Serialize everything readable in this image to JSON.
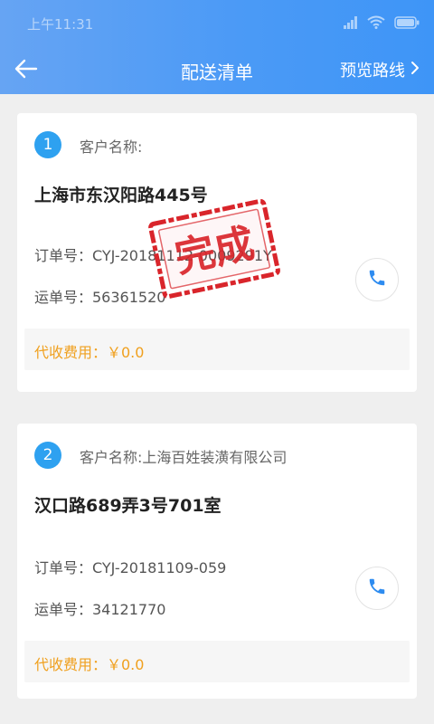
{
  "status_bar": {
    "time": "上午11:31",
    "icons": [
      "signal-icon",
      "wifi-icon",
      "battery-icon"
    ]
  },
  "nav": {
    "title": "配送清单",
    "right_action": "预览路线"
  },
  "orders": [
    {
      "index": "1",
      "customer": "客户名称:",
      "address": "上海市东汉阳路445号",
      "order_no": "订单号：CYJ-20181112-0009291Y",
      "waybill_no": "运单号：56361520",
      "fee": "代收费用：￥0.0",
      "stamp_text": "完成"
    },
    {
      "index": "2",
      "customer": "客户名称:上海百姓装潢有限公司",
      "address": "汉口路689弄3号701室",
      "order_no": "订单号：CYJ-20181109-059",
      "waybill_no": "运单号：34121770",
      "fee": "代收费用：￥0.0"
    }
  ],
  "colors": {
    "header_blue": "#4b9af6",
    "index_blue": "#2ea1f0",
    "fee_orange": "#f0a01e",
    "stamp_red": "#d9252b"
  }
}
